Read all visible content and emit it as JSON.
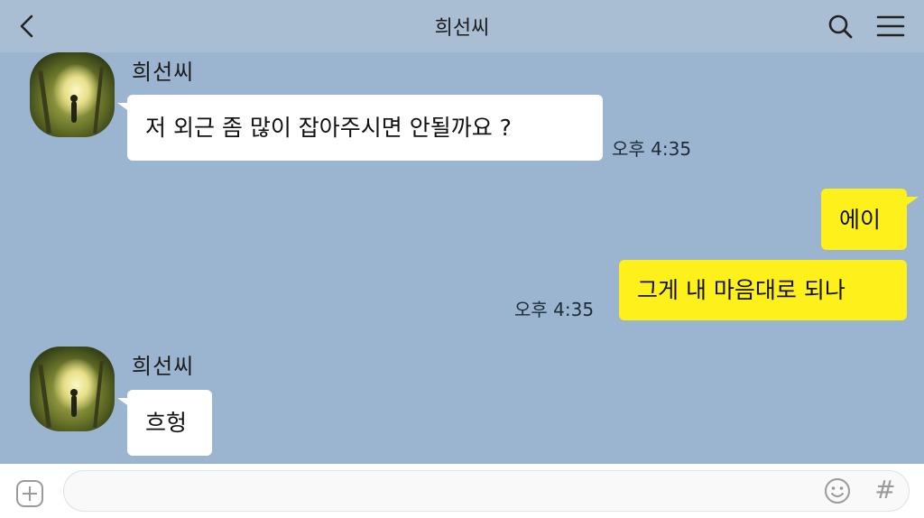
{
  "header": {
    "title": "희선씨",
    "icons": {
      "back": "chevron-left-icon",
      "search": "search-icon",
      "menu": "hamburger-menu-icon"
    }
  },
  "messages": [
    {
      "sender": "희선씨",
      "direction": "incoming",
      "text": "저 외근 좀 많이 잡아주시면 안될까요 ?",
      "time": "오후 4:35"
    },
    {
      "direction": "outgoing",
      "text": "에이"
    },
    {
      "direction": "outgoing",
      "text": "그게 내 마음대로 되나",
      "time": "오후 4:35"
    },
    {
      "sender": "희선씨",
      "direction": "incoming",
      "text": "흐헝"
    }
  ],
  "input_bar": {
    "placeholder": "",
    "icons": {
      "attach": "plus-square-icon",
      "emoji": "smiley-icon",
      "hashtag": "hash-icon"
    },
    "hash_label": "#"
  },
  "colors": {
    "chat_background": "#9bb5d0",
    "header_background": "#a9bed3",
    "incoming_bubble": "#ffffff",
    "outgoing_bubble": "#fef01b"
  }
}
